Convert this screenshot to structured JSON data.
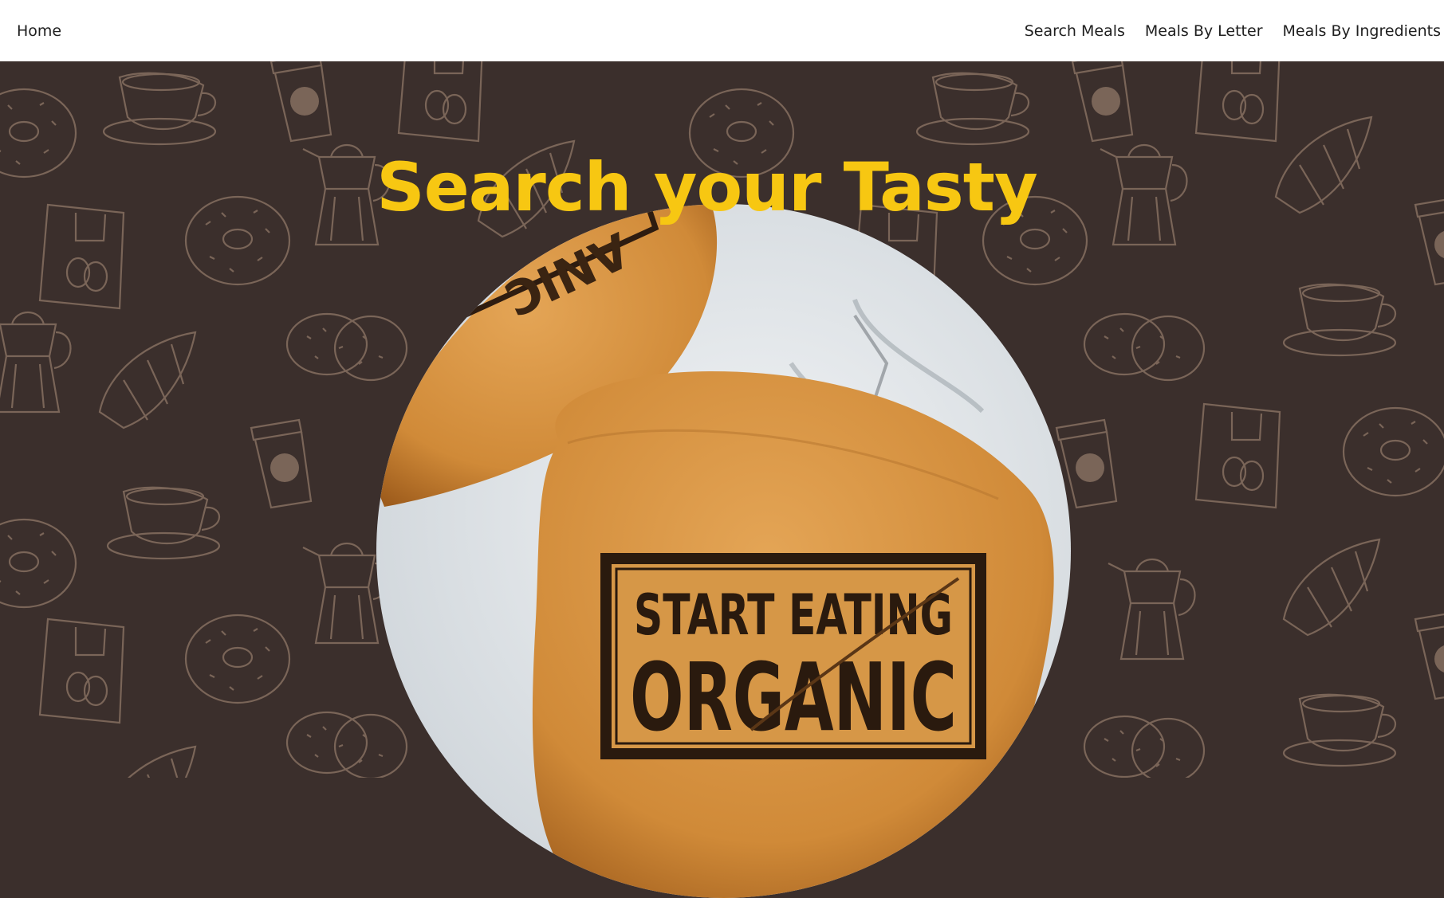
{
  "nav": {
    "home": "Home",
    "links": [
      "Search Meals",
      "Meals By Letter",
      "Meals By Ingredients"
    ]
  },
  "hero": {
    "title": "Search your Tasty",
    "image": {
      "description_icon": "organic-bread-photo",
      "stamp_line1": "START EATING",
      "stamp_line2": "ORGANIC"
    },
    "background_pattern_icons": [
      "coffee-cup-icon",
      "moka-pot-icon",
      "donut-icon",
      "cookie-icon",
      "croissant-icon",
      "coffee-bag-icon",
      "takeaway-cup-icon"
    ]
  },
  "colors": {
    "background": "#3b2f2c",
    "pattern_line": "#7a6558",
    "title": "#f7c712",
    "navbar": "#ffffff",
    "nav_text": "#1f1f1f"
  }
}
